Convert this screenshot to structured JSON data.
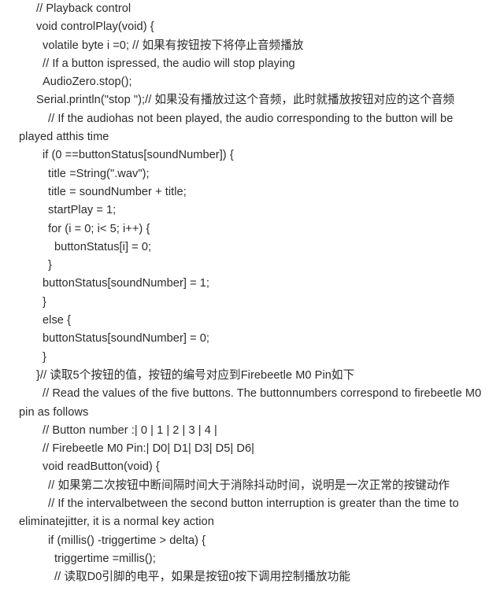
{
  "document": {
    "kind": "code-listing",
    "language": "arduino-cpp",
    "text_color": "#2b2b2b",
    "background_color": "#ffffff",
    "lines": [
      {
        "indent": 2,
        "text": "// Playback control"
      },
      {
        "indent": 2,
        "text": "void controlPlay(void) {"
      },
      {
        "indent": 3,
        "text": "volatile byte i =0;  // 如果有按钮按下将停止音频播放"
      },
      {
        "indent": 3,
        "text": "// If a button ispressed, the audio will stop playing"
      },
      {
        "indent": 3,
        "text": "AudioZero.stop();"
      },
      {
        "indent": 2,
        "text": "Serial.println(\"stop \");// 如果没有播放过这个音频，此时就播放按钮对应的这个音频"
      },
      {
        "indent": 4,
        "text": "// If the audiohas not been played, the audio corresponding to the button will be played atthis time"
      },
      {
        "indent": 3,
        "text": "if (0 ==buttonStatus[soundNumber]) {"
      },
      {
        "indent": 4,
        "text": "title =String(\".wav\");"
      },
      {
        "indent": 4,
        "text": "title =  soundNumber + title;"
      },
      {
        "indent": 4,
        "text": "startPlay = 1;"
      },
      {
        "indent": 4,
        "text": "for (i = 0; i< 5; i++) {"
      },
      {
        "indent": 5,
        "text": "buttonStatus[i] = 0;"
      },
      {
        "indent": 4,
        "text": "}"
      },
      {
        "indent": 3,
        "text": "buttonStatus[soundNumber] = 1;"
      },
      {
        "indent": 3,
        "text": "}"
      },
      {
        "indent": 3,
        "text": "else {"
      },
      {
        "indent": 3,
        "text": "buttonStatus[soundNumber] = 0;"
      },
      {
        "indent": 3,
        "text": "}"
      },
      {
        "indent": 2,
        "text": "}// 读取5个按钮的值，按钮的编号对应到Firebeetle M0 Pin如下"
      },
      {
        "indent": 3,
        "text": "// Read the values of the five buttons. The buttonnumbers correspond to firebeetle M0 pin as follows"
      },
      {
        "indent": 3,
        "text": "// Button number     :| 0 | 1 | 2 | 3 | 4 |"
      },
      {
        "indent": 3,
        "text": "// Firebeetle M0   Pin:| D0| D1| D3| D5| D6|"
      },
      {
        "indent": 3,
        "text": "void readButton(void) {"
      },
      {
        "indent": 4,
        "text": "// 如果第二次按钮中断间隔时间大于消除抖动时间，说明是一次正常的按键动作"
      },
      {
        "indent": 4,
        "text": "// If the intervalbetween the second button interruption is greater than the time to eliminatejitter, it is a normal key action"
      },
      {
        "indent": 4,
        "text": "if (millis() -triggertime > delta) {"
      },
      {
        "indent": 5,
        "text": "triggertime =millis();"
      },
      {
        "indent": 5,
        "text": "// 读取D0引脚的电平，如果是按钮0按下调用控制播放功能"
      }
    ]
  }
}
